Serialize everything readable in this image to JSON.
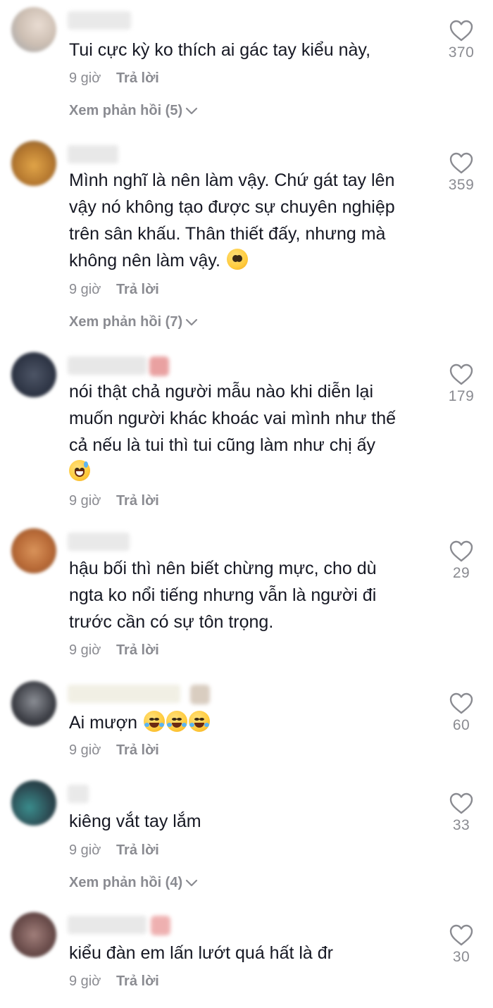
{
  "comments": [
    {
      "lines": [
        "Tui cực kỳ ko thích ai gác tay kiểu này,"
      ],
      "time": "9 giờ",
      "reply_label": "Trả lời",
      "likes": "370",
      "view_replies": "Xem phản hồi (5)"
    },
    {
      "lines": [
        "Mình nghĩ là nên làm vậy. Chứ gát tay lên",
        "vậy nó không tạo được sự chuyên nghiệp",
        "trên sân khấu. Thân thiết đấy, nhưng mà",
        "không nên làm vậy."
      ],
      "emoji": "pleading-face-emoji",
      "time": "9 giờ",
      "reply_label": "Trả lời",
      "likes": "359",
      "view_replies": "Xem phản hồi (7)"
    },
    {
      "lines": [
        "nói thật chả người mẫu nào khi diễn lại",
        "muốn người khác khoác vai mình như thế",
        "cả nếu là tui thì tui cũng làm như chị ấy"
      ],
      "emoji": "grinning-sweat-emoji",
      "time": "9 giờ",
      "reply_label": "Trả lời",
      "likes": "179"
    },
    {
      "lines": [
        "hậu bối thì nên biết chừng mực, cho dù",
        "ngta ko nổi tiếng nhưng vẫn là người đi",
        "trước cần có sự tôn trọng."
      ],
      "time": "9 giờ",
      "reply_label": "Trả lời",
      "likes": "29"
    },
    {
      "lines": [
        "Ai mượn"
      ],
      "emoji": "tears-of-joy-emoji x3",
      "time": "9 giờ",
      "reply_label": "Trả lời",
      "likes": "60"
    },
    {
      "lines": [
        "kiêng vắt tay lắm"
      ],
      "time": "9 giờ",
      "reply_label": "Trả lời",
      "likes": "33",
      "view_replies": "Xem phản hồi (4)"
    },
    {
      "lines": [
        "kiểu đàn em lấn lướt quá hất là đr"
      ],
      "time": "9 giờ",
      "reply_label": "Trả lời",
      "likes": "30"
    }
  ],
  "icons": {
    "like": "heart-outline-icon",
    "expand": "chevron-down-icon"
  },
  "colors": {
    "text": "#161823",
    "muted": "#8a8b91",
    "background": "#ffffff"
  }
}
